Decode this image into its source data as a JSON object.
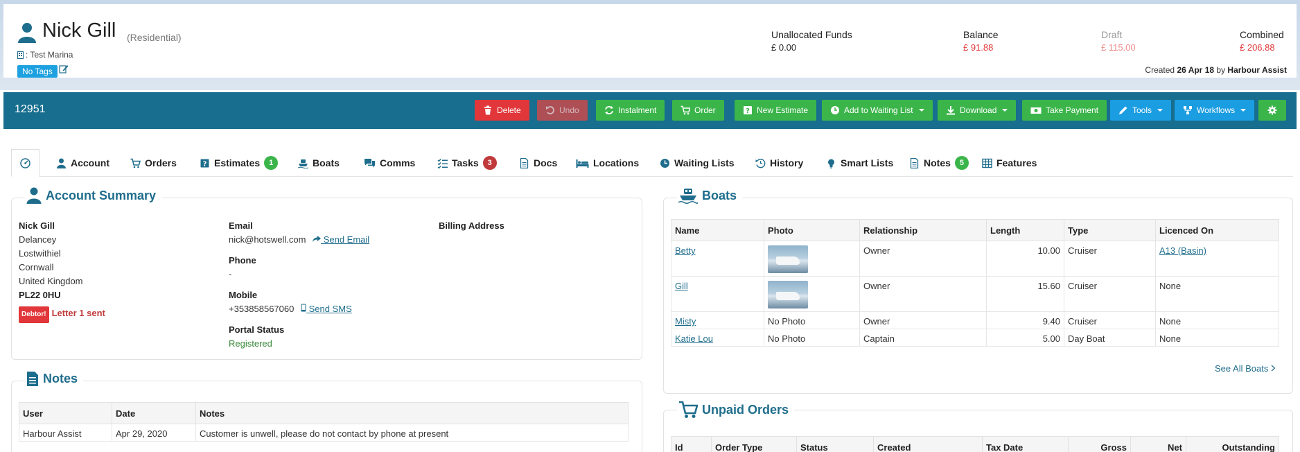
{
  "header": {
    "customer_name": "Nick Gill",
    "customer_type": "(Residential)",
    "marina": ": Test Marina",
    "tags": "No Tags",
    "funds": [
      {
        "label": "Unallocated Funds",
        "value": "£ 0.00",
        "color": "#222222",
        "label_color": "#222222"
      },
      {
        "label": "Balance",
        "value": "£ 91.88",
        "color": "#e2373a",
        "label_color": "#222222"
      },
      {
        "label": "Draft",
        "value": "£ 115.00",
        "color": "#f08a8a",
        "label_color": "#999999"
      },
      {
        "label": "Combined",
        "value": "£ 206.88",
        "color": "#e2373a",
        "label_color": "#222222"
      }
    ],
    "created_prefix": "Created",
    "created_date": "26 Apr 18",
    "created_by_prefix": "by",
    "created_by": "Harbour Assist"
  },
  "toolbar": {
    "record_id": "12951",
    "buttons": {
      "delete": "Delete",
      "undo": "Undo",
      "instalment": "Instalment",
      "order": "Order",
      "new_estimate": "New Estimate",
      "add_waiting": "Add to Waiting List",
      "download": "Download",
      "take_payment": "Take Payment",
      "tools": "Tools",
      "workflows": "Workflows"
    }
  },
  "tabs": {
    "account": "Account",
    "orders": "Orders",
    "estimates": "Estimates",
    "estimates_count": "1",
    "boats": "Boats",
    "comms": "Comms",
    "tasks": "Tasks",
    "tasks_count": "3",
    "docs": "Docs",
    "locations": "Locations",
    "waiting_lists": "Waiting Lists",
    "history": "History",
    "smart_lists": "Smart Lists",
    "notes": "Notes",
    "notes_count": "5",
    "features": "Features"
  },
  "account_summary": {
    "title": "Account Summary",
    "address": {
      "name": "Nick Gill",
      "line1": "Delancey",
      "line2": "Lostwithiel",
      "line3": "Cornwall",
      "line4": "United Kingdom",
      "postcode": "PL22 0HU"
    },
    "debtor_badge": "Debtor!",
    "debtor_text": "Letter 1 sent",
    "email_label": "Email",
    "email": "nick@hotswell.com",
    "send_email": " Send Email",
    "phone_label": "Phone",
    "phone": "-",
    "mobile_label": "Mobile",
    "mobile": "+353858567060",
    "send_sms": "Send SMS",
    "portal_label": "Portal Status",
    "portal_status": "Registered",
    "billing_label": "Billing Address"
  },
  "notes_panel": {
    "title": "Notes",
    "columns": [
      "User",
      "Date",
      "Notes"
    ],
    "rows": [
      {
        "user": "Harbour Assist",
        "date": "Apr 29, 2020",
        "note": "Customer is unwell, please do not contact by phone at present"
      }
    ]
  },
  "boats_panel": {
    "title": "Boats",
    "columns": [
      "Name",
      "Photo",
      "Relationship",
      "Length",
      "Type",
      "Licenced On"
    ],
    "rows": [
      {
        "name": "Betty",
        "photo": "",
        "relationship": "Owner",
        "length": "10.00",
        "type": "Cruiser",
        "licenced": "A13 (Basin)"
      },
      {
        "name": "Gill",
        "photo": "",
        "relationship": "Owner",
        "length": "15.60",
        "type": "Cruiser",
        "licenced": "None"
      },
      {
        "name": "Misty",
        "photo": "No Photo",
        "relationship": "Owner",
        "length": "9.40",
        "type": "Cruiser",
        "licenced": "None"
      },
      {
        "name": "Katie Lou",
        "photo": "No Photo",
        "relationship": "Captain",
        "length": "5.00",
        "type": "Day Boat",
        "licenced": "None"
      }
    ],
    "see_all": "See All Boats"
  },
  "unpaid_orders": {
    "title": "Unpaid Orders",
    "columns": [
      "Id",
      "Order Type",
      "Status",
      "Created",
      "Tax Date",
      "Gross",
      "Net",
      "Outstanding"
    ]
  }
}
